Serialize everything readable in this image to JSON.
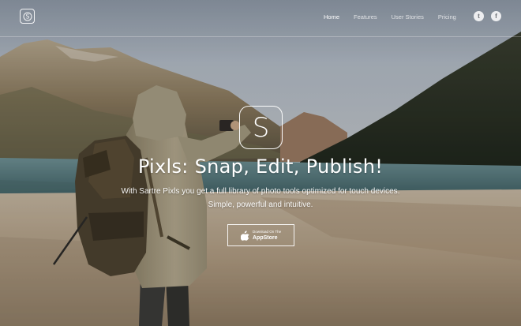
{
  "brand": {
    "logo_letter": "S"
  },
  "nav": {
    "items": [
      {
        "label": "Home",
        "active": true
      },
      {
        "label": "Features",
        "active": false
      },
      {
        "label": "User Stories",
        "active": false
      },
      {
        "label": "Pricing",
        "active": false
      }
    ],
    "social": {
      "twitter_glyph": "t",
      "facebook_glyph": "f"
    }
  },
  "hero": {
    "icon_letter": "S",
    "title": "Pixls: Snap, Edit, Publish!",
    "subtitle_line1": "With Sartre Pixls you get a full library of photo tools optimized for touch devices.",
    "subtitle_line2": "Simple, powerful and intuitive.",
    "store_button": {
      "small_label": "Download On The",
      "big_label": "AppStore"
    }
  },
  "icons": {
    "logo": "s-logo-icon",
    "twitter": "twitter-icon",
    "facebook": "facebook-icon",
    "apple": "apple-icon"
  },
  "colors": {
    "sky": "#9aa6b4",
    "mountain_left": "#8a7a63",
    "mountain_right": "#2c3226",
    "lake": "#567a7d",
    "ground": "#b8aa96",
    "jacket": "#a79c83",
    "backpack": "#4e4331"
  }
}
